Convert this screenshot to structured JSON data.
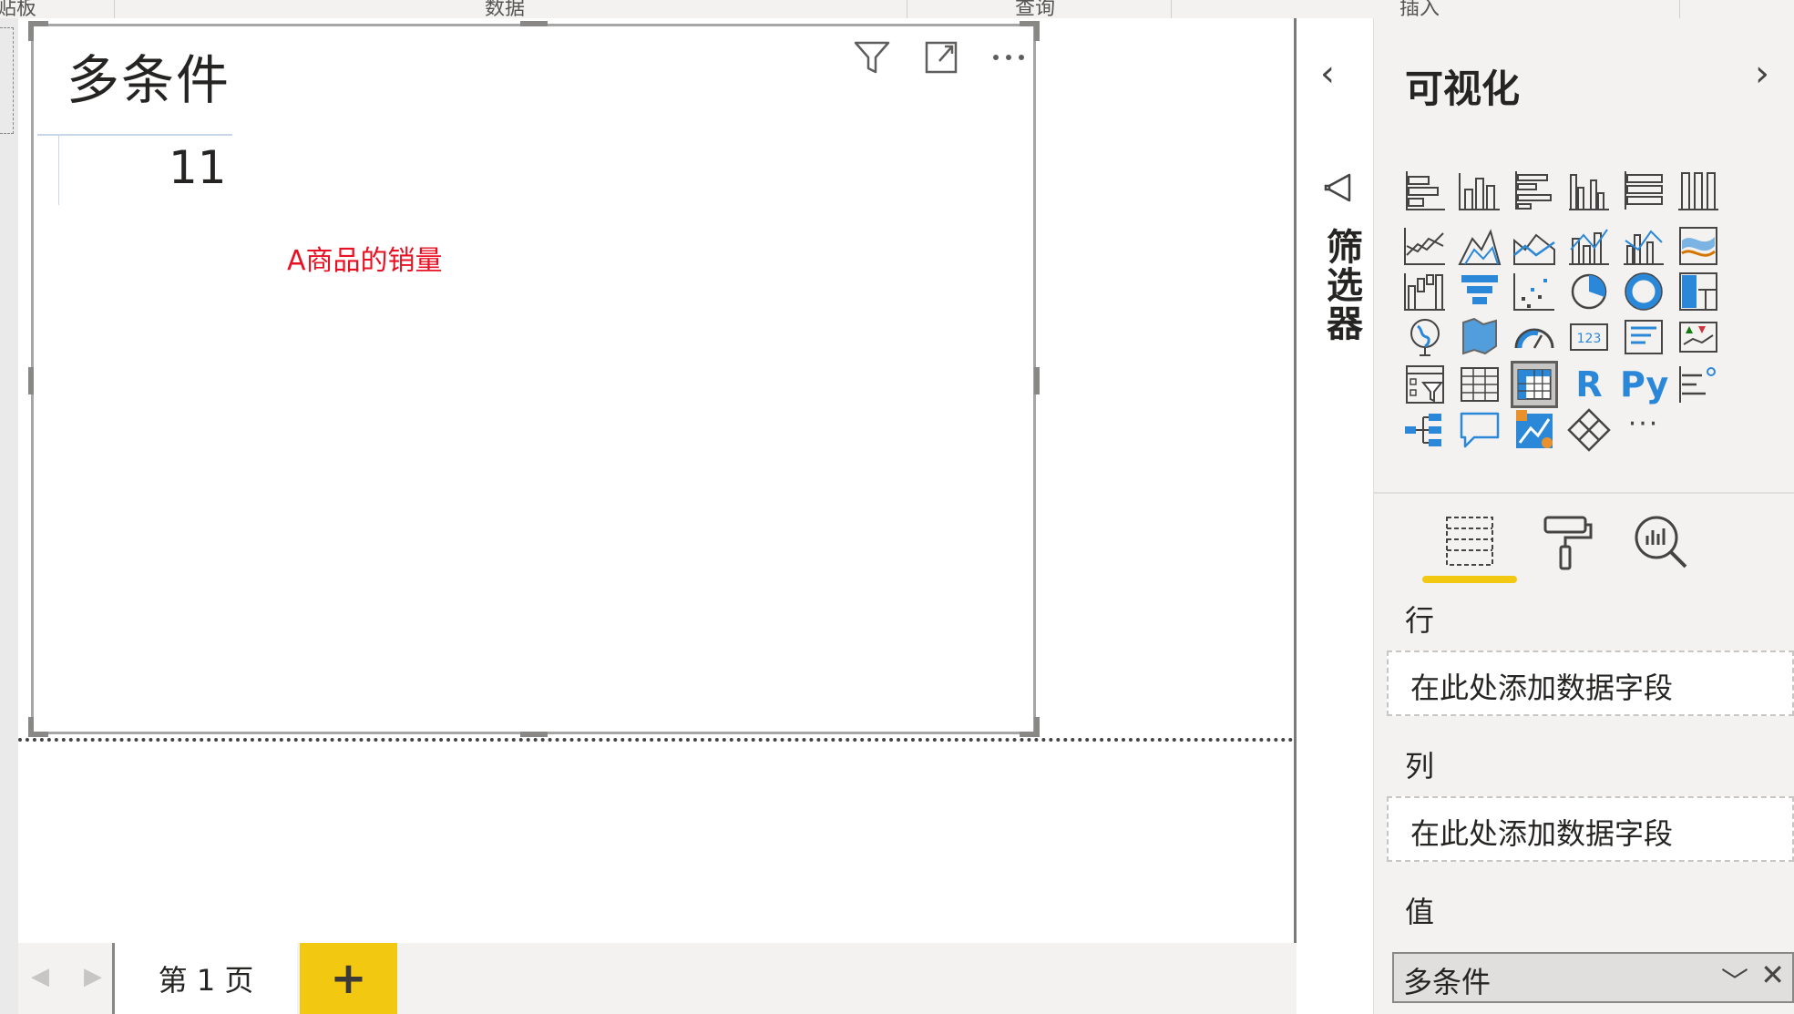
{
  "ribbon": {
    "tabs": [
      "贴板",
      "数据",
      "查询",
      "插入"
    ]
  },
  "visual": {
    "title": "多条件",
    "value": "11",
    "annotation": "A商品的销量"
  },
  "pages": {
    "current_tab": "第 1 页",
    "add_label": "+"
  },
  "filters": {
    "label": "筛选器"
  },
  "viz_pane": {
    "title": "可视化",
    "rows_label": "行",
    "rows_placeholder": "在此处添加数据字段",
    "cols_label": "列",
    "cols_placeholder": "在此处添加数据字段",
    "values_label": "值",
    "values_field": "多条件",
    "more_label": "···",
    "r_label": "R",
    "py_label": "Py"
  },
  "colors": {
    "accent": "#f2c811",
    "annotation": "#e81123"
  }
}
